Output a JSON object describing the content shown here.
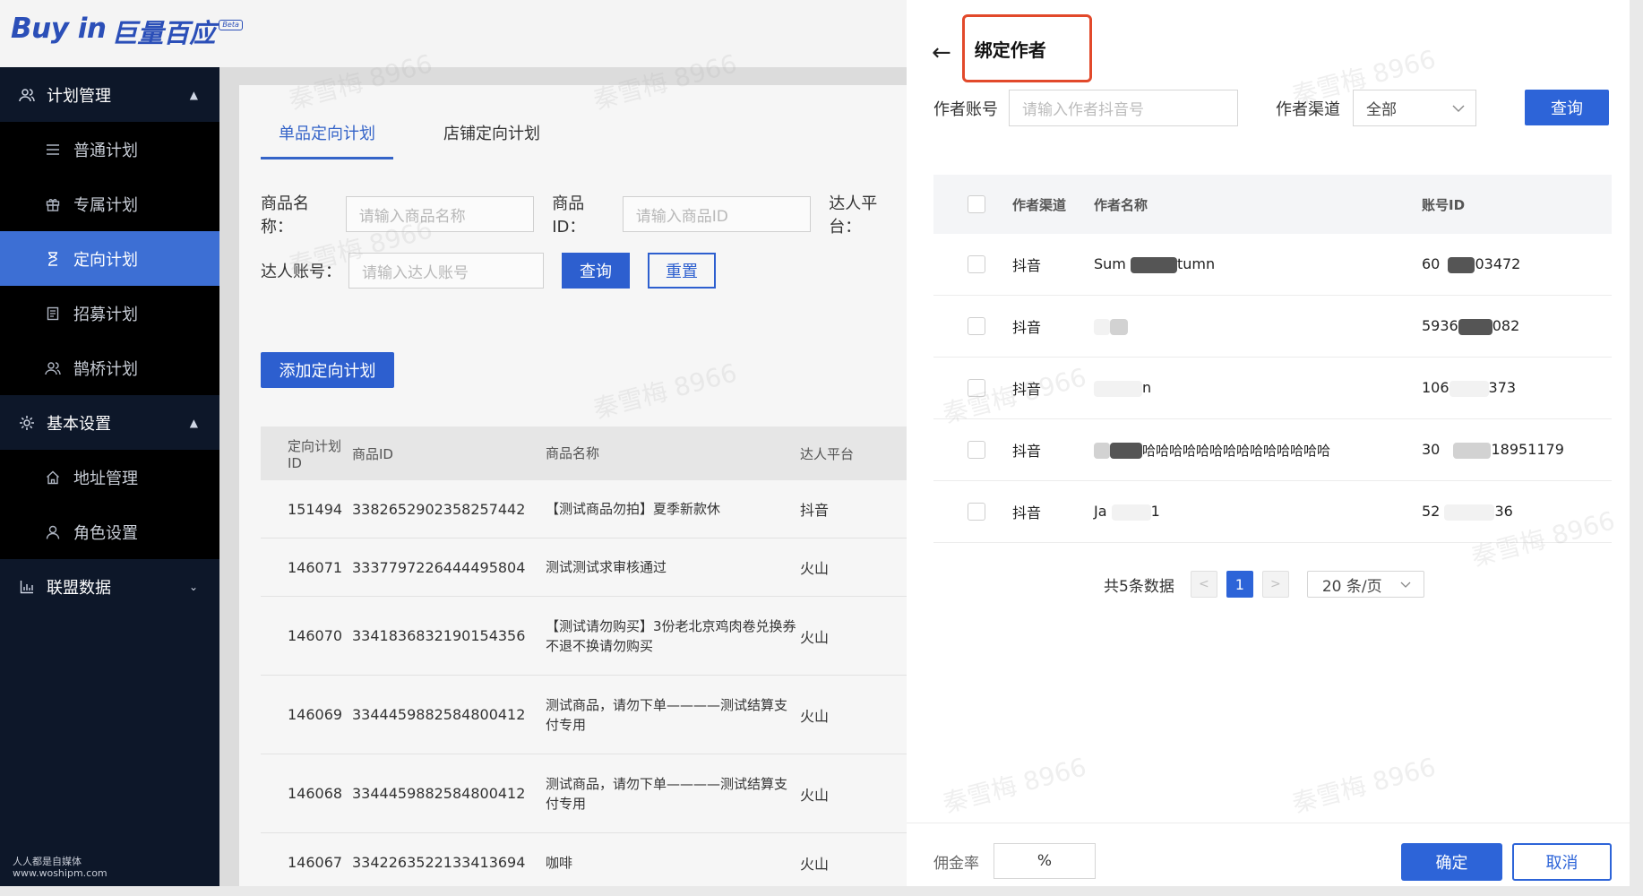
{
  "logo": {
    "text_en": "Buy in",
    "text_cn": "巨量百应",
    "badge": "Beta"
  },
  "sidebar": {
    "groups": [
      {
        "label": "计划管理",
        "icon": "people-icon",
        "caret": "▲"
      },
      {
        "label": "基本设置",
        "icon": "gear-icon",
        "caret": "▲"
      },
      {
        "label": "联盟数据",
        "icon": "bar-chart-icon",
        "caret": "⌄"
      }
    ],
    "items": [
      {
        "label": "普通计划",
        "icon": "list-icon"
      },
      {
        "label": "专属计划",
        "icon": "gift-icon"
      },
      {
        "label": "定向计划",
        "icon": "hourglass-icon"
      },
      {
        "label": "招募计划",
        "icon": "document-icon"
      },
      {
        "label": "鹊桥计划",
        "icon": "people-icon"
      },
      {
        "label": "地址管理",
        "icon": "home-icon"
      },
      {
        "label": "角色设置",
        "icon": "user-icon"
      }
    ],
    "footer_line1": "人人都是自媒体",
    "footer_line2": "www.woshipm.com"
  },
  "main": {
    "tabs": [
      "单品定向计划",
      "店铺定向计划"
    ],
    "filters": {
      "product_name_label": "商品名称：",
      "product_name_placeholder": "请输入商品名称",
      "product_id_label": "商品ID：",
      "product_id_placeholder": "请输入商品ID",
      "platform_label": "达人平台：",
      "account_label": "达人账号：",
      "account_placeholder": "请输入达人账号",
      "query": "查询",
      "reset": "重置"
    },
    "add_button": "添加定向计划",
    "table": {
      "headers": [
        "定向计划ID",
        "商品ID",
        "商品名称",
        "达人平台"
      ],
      "rows": [
        {
          "id": "151494",
          "pid": "3382652902358257442",
          "name": "【测试商品勿拍】夏季新款休",
          "platform": "抖音"
        },
        {
          "id": "146071",
          "pid": "3337797226444495804",
          "name": "测试测试求审核通过",
          "platform": "火山"
        },
        {
          "id": "146070",
          "pid": "3341836832190154356",
          "name": "【测试请勿购买】3份老北京鸡肉卷兑换券 不退不换请勿购买",
          "platform": "火山"
        },
        {
          "id": "146069",
          "pid": "3344459882584800412",
          "name": "测试商品，请勿下单————测试结算支付专用",
          "platform": "火山"
        },
        {
          "id": "146068",
          "pid": "3344459882584800412",
          "name": "测试商品，请勿下单————测试结算支付专用",
          "platform": "火山"
        },
        {
          "id": "146067",
          "pid": "3342263522133413694",
          "name": "咖啡",
          "platform": "火山"
        }
      ]
    }
  },
  "drawer": {
    "back_icon": "←",
    "title": "绑定作者",
    "account_label": "作者账号",
    "account_placeholder": "请输入作者抖音号",
    "channel_label": "作者渠道",
    "channel_value": "全部",
    "query": "查询",
    "table": {
      "headers": [
        "作者渠道",
        "作者名称",
        "账号ID"
      ],
      "rows": [
        {
          "channel": "抖音",
          "name_pre": "Sum",
          "name_post": "tumn",
          "id_pre": "60",
          "id_post": "03472"
        },
        {
          "channel": "抖音",
          "name_pre": "",
          "name_post": "",
          "id_pre": "5936",
          "id_post": "082"
        },
        {
          "channel": "抖音",
          "name_pre": "",
          "name_post": "n",
          "id_pre": "106",
          "id_post": "373"
        },
        {
          "channel": "抖音",
          "name_pre": "",
          "name_post": "哈哈哈哈哈哈哈哈哈哈哈哈哈哈",
          "id_pre": "30",
          "id_post": "18951179"
        },
        {
          "channel": "抖音",
          "name_pre": "Ja",
          "name_post": "1",
          "id_pre": "52",
          "id_post": "36"
        }
      ]
    },
    "pagination": {
      "total": "共5条数据",
      "prev": "<",
      "current": "1",
      "next": ">",
      "page_size": "20 条/页"
    },
    "commission_label": "佣金率",
    "commission_suffix": "%",
    "confirm": "确定",
    "cancel": "取消"
  },
  "watermark": "秦雪梅 8966"
}
